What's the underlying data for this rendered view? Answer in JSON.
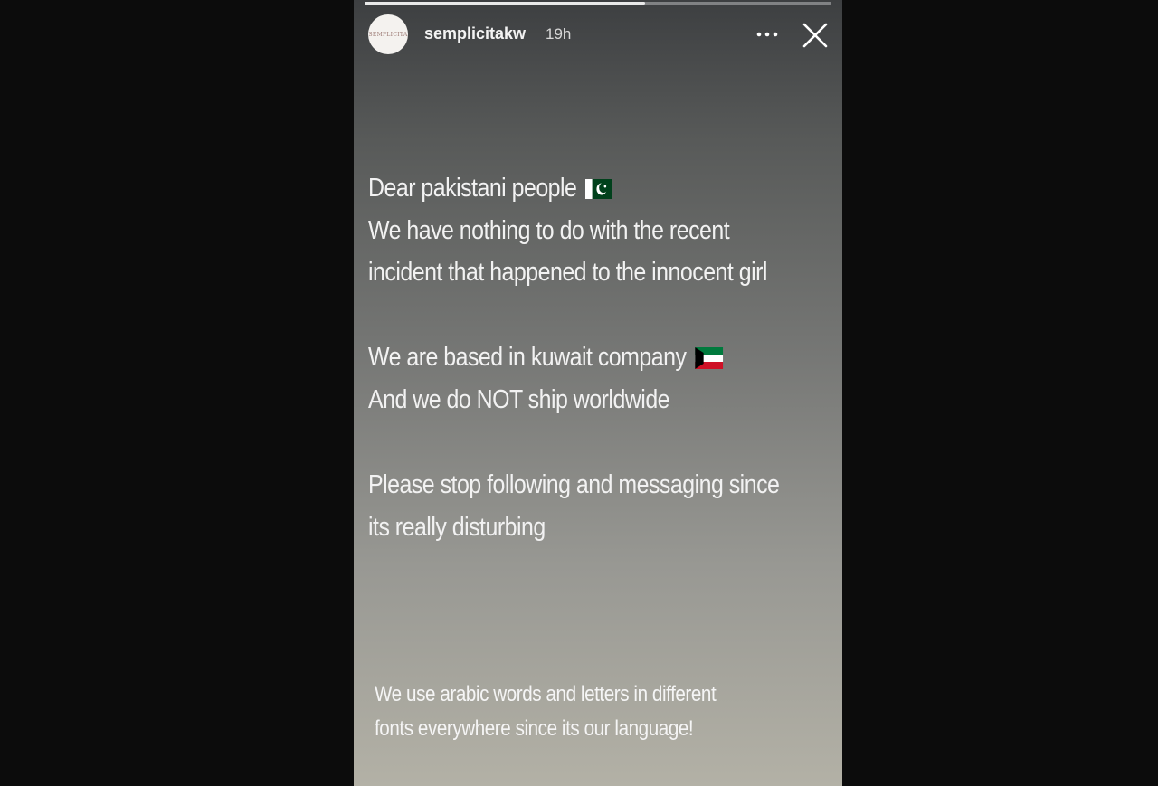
{
  "story": {
    "progress": 0.6,
    "username": "semplicitakw",
    "avatar_text": "SEMPLICITA",
    "timestamp": "19h",
    "more_icon": "more-horizontal-icon",
    "close_icon": "close-icon"
  },
  "message": {
    "line1": "Dear pakistani people",
    "line2": "We have nothing to do with the recent",
    "line3": "incident that happened to the innocent girl",
    "line4": "We are based in kuwait  company",
    "line5": "And we do NOT ship worldwide",
    "line6": "Please stop following and messaging since",
    "line7": "its really disturbing"
  },
  "note": {
    "line1": "We use arabic words and letters in different",
    "line2": "fonts everywhere since its our language!"
  },
  "colors": {
    "background": "#0c0c0c",
    "text": "#f2f2f2",
    "pakistan_green": "#01411c",
    "kuwait_green": "#007a3d",
    "kuwait_red": "#ce1126"
  }
}
